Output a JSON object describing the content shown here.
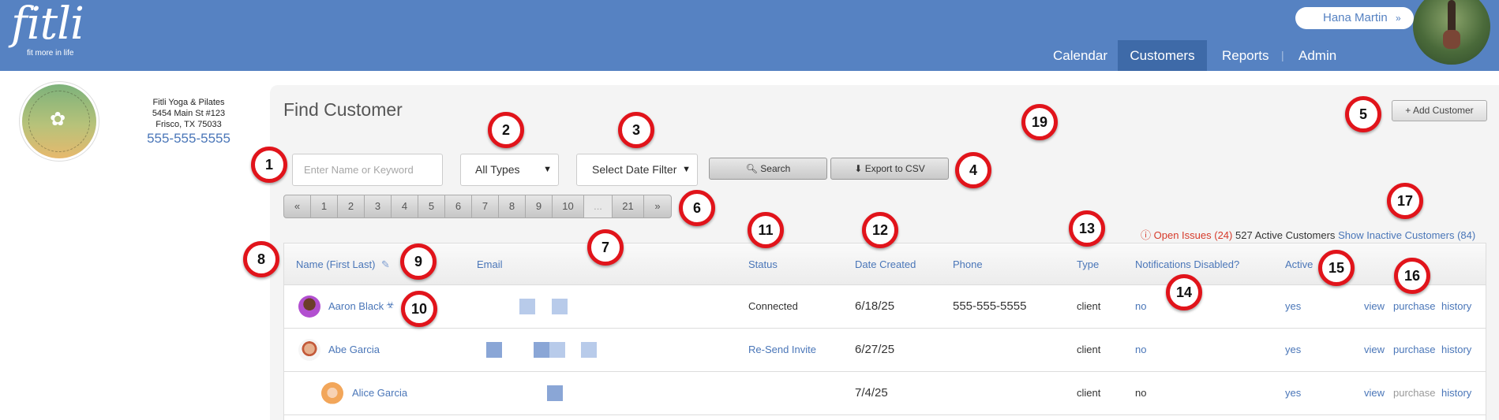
{
  "header": {
    "logo_text": "fitli",
    "logo_tagline": "fit more in life",
    "user_name": "Hana Martin",
    "user_chevron": "»",
    "nav": {
      "calendar": "Calendar",
      "customers": "Customers",
      "reports": "Reports",
      "separator": "|",
      "admin": "Admin"
    }
  },
  "studio": {
    "logo_text": "FITLI YOGA & PILATES",
    "name": "Fitli Yoga & Pilates",
    "address_line1": "5454 Main St #123",
    "address_line2": "Frisco, TX 75033",
    "phone": "555-555-5555"
  },
  "page": {
    "title": "Find Customer",
    "add_button": "+ Add Customer"
  },
  "filters": {
    "search_placeholder": "Enter Name or Keyword",
    "type_select": "All Types",
    "date_select": "Select Date Filter",
    "search_button": "Search",
    "export_button": "Export to CSV"
  },
  "pagination": [
    "«",
    "1",
    "2",
    "3",
    "4",
    "5",
    "6",
    "7",
    "8",
    "9",
    "10",
    "...",
    "21",
    "»"
  ],
  "summary": {
    "open_issues": "Open Issues (24)",
    "active_count": "527 Active Customers",
    "show_inactive": "Show Inactive Customers (84)"
  },
  "table": {
    "headers": {
      "name": "Name (First Last)",
      "email": "Email",
      "status": "Status",
      "date_created": "Date Created",
      "phone": "Phone",
      "type": "Type",
      "notifications": "Notifications Disabled?",
      "active": "Active"
    },
    "rows": [
      {
        "name": "Aaron Black",
        "status": "Connected",
        "date": "6/18/25",
        "phone": "555-555-5555",
        "type": "client",
        "notifications": "no",
        "active": "yes",
        "view": "view",
        "purchase": "purchase",
        "history": "history"
      },
      {
        "name": "Abe Garcia",
        "status": "Re-Send Invite",
        "date": "6/27/25",
        "phone": "",
        "type": "client",
        "notifications": "no",
        "active": "yes",
        "view": "view",
        "purchase": "purchase",
        "history": "history"
      },
      {
        "name": "Alice Garcia",
        "status": "",
        "date": "7/4/25",
        "phone": "",
        "type": "client",
        "notifications": "no",
        "active": "yes",
        "view": "view",
        "purchase": "purchase",
        "history": "history"
      }
    ]
  },
  "callouts": [
    "1",
    "2",
    "3",
    "4",
    "5",
    "6",
    "7",
    "8",
    "9",
    "10",
    "11",
    "12",
    "13",
    "14",
    "15",
    "16",
    "17",
    "19"
  ],
  "colors": {
    "header_bg": "#5682c2",
    "nav_active_bg": "#3e6aa8",
    "link": "#4a76b8",
    "issues": "#d63a2a",
    "callout_ring": "#e1141b"
  }
}
